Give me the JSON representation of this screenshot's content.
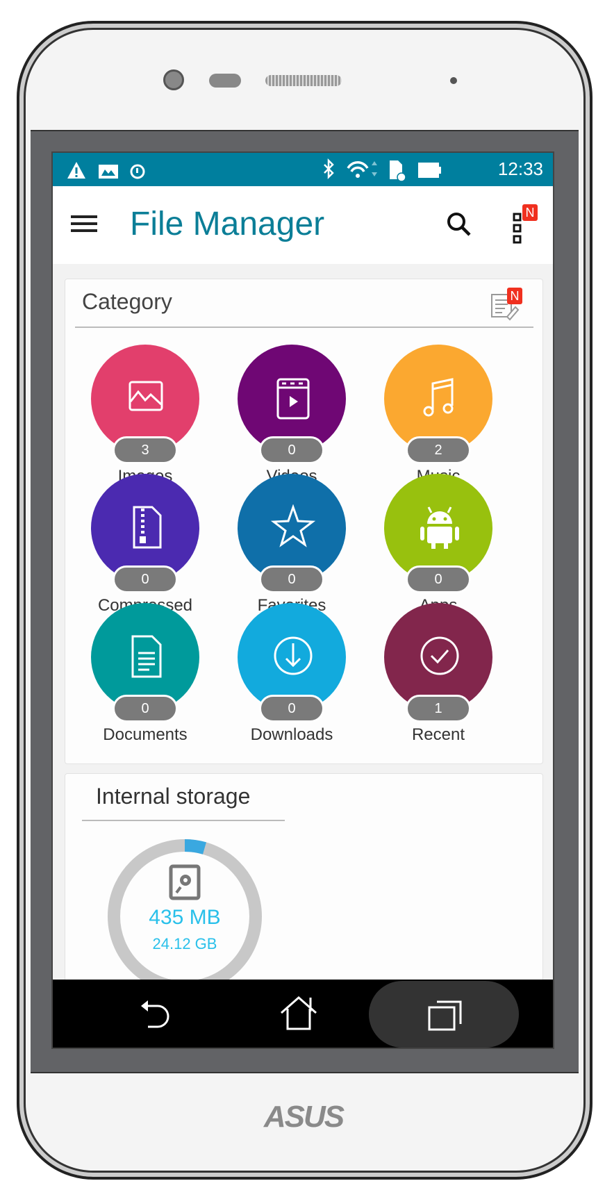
{
  "status_bar": {
    "time": "12:33",
    "icons": [
      "warning-icon",
      "image-icon",
      "data-saver-icon",
      "bluetooth-icon",
      "wifi-icon",
      "sd-card-icon",
      "battery-icon"
    ]
  },
  "app_bar": {
    "title": "File Manager",
    "menu_icon": "hamburger-icon",
    "search_icon": "search-icon",
    "more_icon": "more-icon",
    "new_badge": "N"
  },
  "category": {
    "title": "Category",
    "edit_badge": "N",
    "items": [
      {
        "label": "Images",
        "count": "3",
        "color": "#e23f6c",
        "icon": "image-icon"
      },
      {
        "label": "Videos",
        "count": "0",
        "color": "#6f0774",
        "icon": "video-icon"
      },
      {
        "label": "Music",
        "count": "2",
        "color": "#fba830",
        "icon": "music-icon"
      },
      {
        "label": "Compressed",
        "count": "0",
        "color": "#4b2ab0",
        "icon": "zip-icon"
      },
      {
        "label": "Favorites",
        "count": "0",
        "color": "#0f6fa9",
        "icon": "star-icon"
      },
      {
        "label": "Apps",
        "count": "0",
        "color": "#98c10e",
        "icon": "android-icon"
      },
      {
        "label": "Documents",
        "count": "0",
        "color": "#009a9b",
        "icon": "document-icon"
      },
      {
        "label": "Downloads",
        "count": "0",
        "color": "#12aadd",
        "icon": "download-icon"
      },
      {
        "label": "Recent",
        "count": "1",
        "color": "#82264c",
        "icon": "check-icon"
      }
    ]
  },
  "storage": {
    "title": "Internal storage",
    "used": "435 MB",
    "total": "24.12 GB",
    "used_fraction": 0.018
  },
  "nav": {
    "back": "back-icon",
    "home": "home-icon",
    "recents": "recents-icon"
  },
  "brand": "ASUS"
}
